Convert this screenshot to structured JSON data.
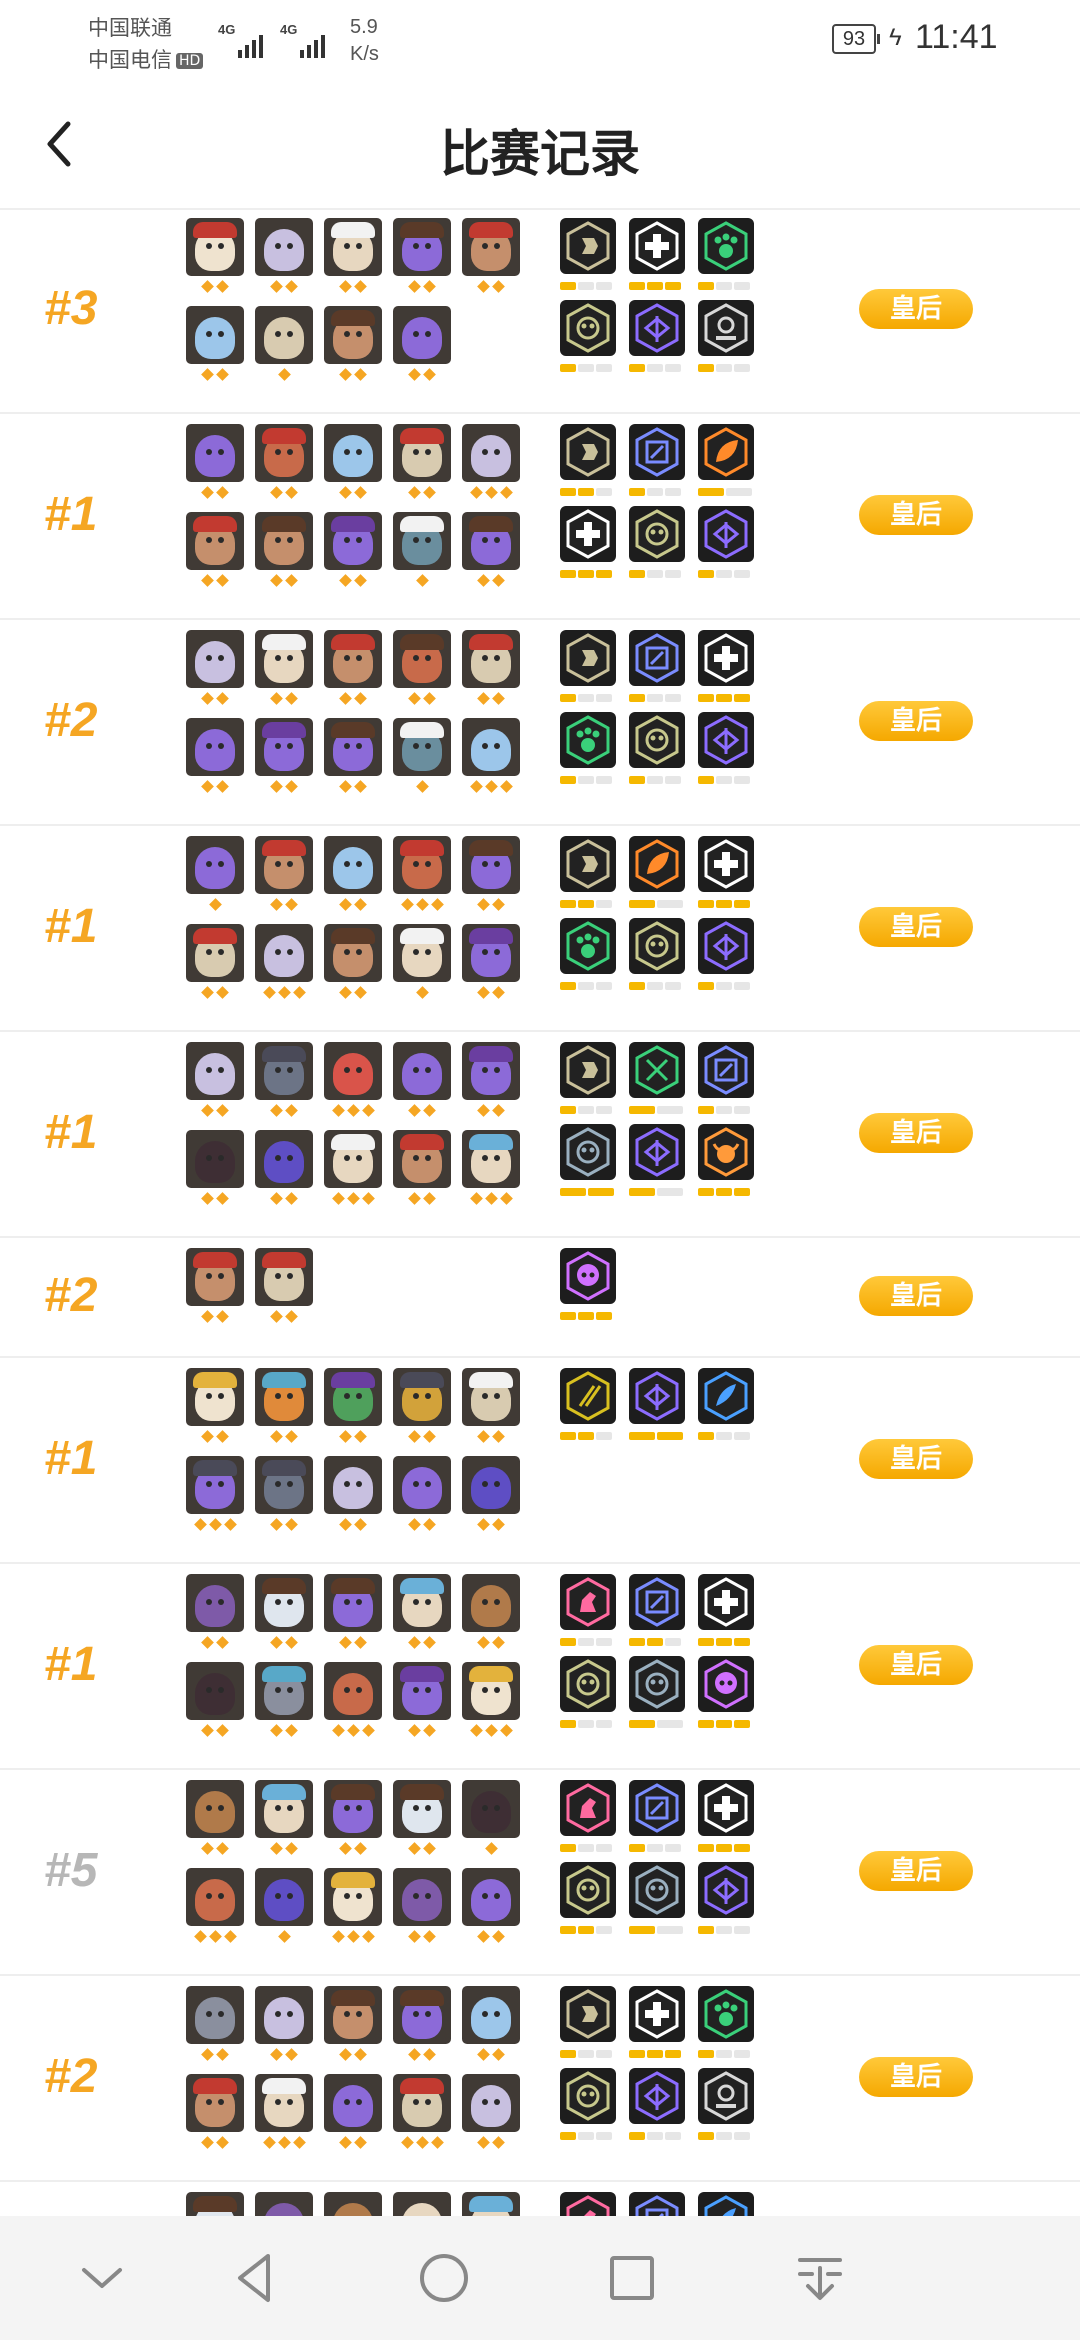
{
  "status_bar": {
    "carrier1": "中国联通",
    "carrier2": "中国电信",
    "hd": "HD",
    "net1": "4G",
    "net2": "4G",
    "speed_value": "5.9",
    "speed_unit": "K/s",
    "battery": "93",
    "time": "11:41"
  },
  "header": {
    "title": "比赛记录"
  },
  "matches": [
    {
      "rank": "#3",
      "tag": "皇后",
      "units": [
        [
          [
            2,
            "cream",
            "red"
          ],
          [
            2,
            "lilac",
            null
          ],
          [
            2,
            "beige",
            "white"
          ],
          [
            2,
            "violet",
            "horn"
          ],
          [
            2,
            "tan",
            "red"
          ]
        ],
        [
          [
            2,
            "sky",
            null
          ],
          [
            1,
            "bone",
            null
          ],
          [
            2,
            "tan",
            "horn"
          ],
          [
            2,
            "violet",
            null
          ]
        ]
      ],
      "synergies": [
        [
          [
            "axe",
            "#c9c09a",
            1,
            3
          ],
          [
            "cross",
            "#ffffff",
            3,
            3
          ],
          [
            "paw",
            "#3ad07a",
            1,
            3
          ]
        ],
        [
          [
            "claw",
            "#c7c88c",
            1,
            3
          ],
          [
            "fish",
            "#8c6cff",
            1,
            3
          ],
          [
            "ring",
            "#d8d8d8",
            1,
            3
          ]
        ]
      ]
    },
    {
      "rank": "#1",
      "tag": "皇后",
      "units": [
        [
          [
            2,
            "violet",
            null
          ],
          [
            2,
            "rust",
            "red"
          ],
          [
            2,
            "sky",
            null
          ],
          [
            2,
            "bone",
            "red"
          ],
          [
            3,
            "lilac",
            null
          ]
        ],
        [
          [
            2,
            "tan",
            "red"
          ],
          [
            2,
            "tan",
            "horn"
          ],
          [
            2,
            "violet",
            "mask"
          ],
          [
            1,
            "teal",
            "white"
          ],
          [
            2,
            "violet",
            "horn"
          ]
        ]
      ],
      "synergies": [
        [
          [
            "axe",
            "#c9c09a",
            2,
            3
          ],
          [
            "scroll",
            "#7a8cff",
            1,
            3
          ],
          [
            "leaf",
            "#ff8a2a",
            1,
            2
          ]
        ],
        [
          [
            "cross",
            "#ffffff",
            3,
            3
          ],
          [
            "claw",
            "#c7c88c",
            1,
            3
          ],
          [
            "fish",
            "#8c6cff",
            1,
            3
          ]
        ]
      ]
    },
    {
      "rank": "#2",
      "tag": "皇后",
      "units": [
        [
          [
            2,
            "lilac",
            null
          ],
          [
            2,
            "beige",
            "white"
          ],
          [
            2,
            "tan",
            "red"
          ],
          [
            2,
            "rust",
            "horn"
          ],
          [
            2,
            "bone",
            "red"
          ]
        ],
        [
          [
            2,
            "violet",
            null
          ],
          [
            2,
            "violet",
            "mask"
          ],
          [
            2,
            "violet",
            "horn"
          ],
          [
            1,
            "teal",
            "white"
          ],
          [
            3,
            "sky",
            null
          ]
        ]
      ],
      "synergies": [
        [
          [
            "axe",
            "#c9c09a",
            1,
            3
          ],
          [
            "scroll",
            "#7a8cff",
            1,
            3
          ],
          [
            "cross",
            "#ffffff",
            3,
            3
          ]
        ],
        [
          [
            "paw",
            "#3ad07a",
            1,
            3
          ],
          [
            "claw",
            "#c7c88c",
            1,
            3
          ],
          [
            "fish",
            "#8c6cff",
            1,
            3
          ]
        ]
      ]
    },
    {
      "rank": "#1",
      "tag": "皇后",
      "units": [
        [
          [
            1,
            "violet",
            null
          ],
          [
            2,
            "tan",
            "red"
          ],
          [
            2,
            "sky",
            null
          ],
          [
            3,
            "rust",
            "red"
          ],
          [
            2,
            "violet",
            "horn"
          ]
        ],
        [
          [
            2,
            "bone",
            "red"
          ],
          [
            3,
            "lilac",
            null
          ],
          [
            2,
            "tan",
            "horn"
          ],
          [
            1,
            "beige",
            "white"
          ],
          [
            2,
            "violet",
            "mask"
          ]
        ]
      ],
      "synergies": [
        [
          [
            "axe",
            "#c9c09a",
            2,
            3
          ],
          [
            "leaf",
            "#ff8a2a",
            1,
            2
          ],
          [
            "cross",
            "#ffffff",
            3,
            3
          ]
        ],
        [
          [
            "paw",
            "#3ad07a",
            1,
            3
          ],
          [
            "claw",
            "#c7c88c",
            1,
            3
          ],
          [
            "fish",
            "#8c6cff",
            1,
            3
          ]
        ]
      ]
    },
    {
      "rank": "#1",
      "tag": "皇后",
      "units": [
        [
          [
            2,
            "lilac",
            null
          ],
          [
            2,
            "slate",
            "hood"
          ],
          [
            3,
            "red",
            null
          ],
          [
            2,
            "violet",
            null
          ],
          [
            2,
            "violet",
            "mask"
          ]
        ],
        [
          [
            2,
            "dark",
            null
          ],
          [
            2,
            "indigo",
            null
          ],
          [
            3,
            "beige",
            "white"
          ],
          [
            2,
            "tan",
            "red"
          ],
          [
            3,
            "beige",
            "goggles"
          ]
        ]
      ],
      "synergies": [
        [
          [
            "axe",
            "#c9c09a",
            1,
            3
          ],
          [
            "arrows",
            "#3ad07a",
            1,
            2
          ],
          [
            "scroll",
            "#7a8cff",
            1,
            3
          ]
        ],
        [
          [
            "claw",
            "#9ab0c0",
            2,
            2
          ],
          [
            "fish",
            "#8c6cff",
            1,
            2
          ],
          [
            "bull",
            "#ff9a3a",
            3,
            3
          ]
        ]
      ]
    },
    {
      "rank": "#2",
      "tag": "皇后",
      "units": [
        [
          [
            2,
            "tan",
            "red"
          ],
          [
            2,
            "bone",
            "red"
          ]
        ]
      ],
      "synergies": [
        [
          [
            "skull",
            "#d070ff",
            3,
            3
          ]
        ]
      ]
    },
    {
      "rank": "#1",
      "tag": "皇后",
      "units": [
        [
          [
            2,
            "cream",
            "gold"
          ],
          [
            2,
            "orange",
            "helmet"
          ],
          [
            2,
            "green",
            "mask"
          ],
          [
            2,
            "gold",
            "hood"
          ],
          [
            2,
            "bone",
            "white"
          ]
        ],
        [
          [
            3,
            "violet",
            "hood"
          ],
          [
            2,
            "slate",
            "hood"
          ],
          [
            2,
            "lilac",
            null
          ],
          [
            2,
            "violet",
            null
          ],
          [
            2,
            "indigo",
            null
          ]
        ]
      ],
      "synergies": [
        [
          [
            "swords",
            "#d8c020",
            2,
            3
          ],
          [
            "fish",
            "#8c6cff",
            2,
            2
          ],
          [
            "feather",
            "#4aa0ff",
            1,
            3
          ]
        ]
      ]
    },
    {
      "rank": "#1",
      "tag": "皇后",
      "units": [
        [
          [
            2,
            "purple",
            null
          ],
          [
            2,
            "cloud",
            "horn"
          ],
          [
            2,
            "violet",
            "horn"
          ],
          [
            2,
            "beige",
            "goggles"
          ],
          [
            2,
            "wood",
            null
          ]
        ],
        [
          [
            2,
            "dark",
            null
          ],
          [
            2,
            "gray",
            "helmet"
          ],
          [
            3,
            "rust",
            null
          ],
          [
            2,
            "violet",
            "mask"
          ],
          [
            3,
            "cream",
            "gold"
          ]
        ]
      ],
      "synergies": [
        [
          [
            "knight",
            "#ff6aa0",
            1,
            3
          ],
          [
            "scroll",
            "#7a8cff",
            2,
            3
          ],
          [
            "cross",
            "#ffffff",
            3,
            3
          ]
        ],
        [
          [
            "claw",
            "#c7c88c",
            1,
            3
          ],
          [
            "claw",
            "#9ab0c0",
            1,
            2
          ],
          [
            "skull",
            "#d070ff",
            3,
            3
          ]
        ]
      ]
    },
    {
      "rank": "#5",
      "tag": "皇后",
      "low": true,
      "units": [
        [
          [
            2,
            "wood",
            null
          ],
          [
            2,
            "beige",
            "goggles"
          ],
          [
            2,
            "violet",
            "horn"
          ],
          [
            2,
            "cloud",
            "horn"
          ],
          [
            1,
            "dark",
            null
          ]
        ],
        [
          [
            3,
            "rust",
            null
          ],
          [
            1,
            "indigo",
            null
          ],
          [
            3,
            "cream",
            "gold"
          ],
          [
            2,
            "purple",
            null
          ],
          [
            2,
            "violet",
            null
          ]
        ]
      ],
      "synergies": [
        [
          [
            "knight",
            "#ff6aa0",
            1,
            3
          ],
          [
            "scroll",
            "#7a8cff",
            1,
            3
          ],
          [
            "cross",
            "#ffffff",
            3,
            3
          ]
        ],
        [
          [
            "claw",
            "#c7c88c",
            2,
            3
          ],
          [
            "claw",
            "#9ab0c0",
            1,
            2
          ],
          [
            "fish",
            "#8c6cff",
            1,
            3
          ]
        ]
      ]
    },
    {
      "rank": "#2",
      "tag": "皇后",
      "units": [
        [
          [
            2,
            "gray",
            null
          ],
          [
            2,
            "lilac",
            null
          ],
          [
            2,
            "tan",
            "horn"
          ],
          [
            2,
            "violet",
            "horn"
          ],
          [
            2,
            "sky",
            null
          ]
        ],
        [
          [
            2,
            "tan",
            "red"
          ],
          [
            3,
            "beige",
            "white"
          ],
          [
            2,
            "violet",
            null
          ],
          [
            3,
            "bone",
            "red"
          ],
          [
            2,
            "lilac",
            null
          ]
        ]
      ],
      "synergies": [
        [
          [
            "axe",
            "#c9c09a",
            1,
            3
          ],
          [
            "cross",
            "#ffffff",
            3,
            3
          ],
          [
            "paw",
            "#3ad07a",
            1,
            3
          ]
        ],
        [
          [
            "claw",
            "#c7c88c",
            1,
            3
          ],
          [
            "fish",
            "#8c6cff",
            1,
            3
          ],
          [
            "ring",
            "#d8d8d8",
            1,
            3
          ]
        ]
      ]
    },
    {
      "rank": "",
      "tag": "",
      "units": [
        [
          [
            2,
            "cloud",
            "horn"
          ],
          [
            2,
            "purple",
            null
          ],
          [
            2,
            "wood",
            null
          ],
          [
            2,
            "beige",
            null
          ],
          [
            2,
            "beige",
            "goggles"
          ]
        ]
      ],
      "synergies": [
        [
          [
            "knight",
            "#ff6aa0",
            1,
            3
          ],
          [
            "scroll",
            "#7a8cff",
            1,
            3
          ],
          [
            "feather",
            "#4aa0ff",
            1,
            3
          ]
        ]
      ]
    }
  ],
  "palette": {
    "violet": "#8c6ad8",
    "lilac": "#c8c0e0",
    "sky": "#9cc6ea",
    "cream": "#efe3cf",
    "beige": "#e7d7c0",
    "tan": "#c58f6c",
    "rust": "#c86a4a",
    "bone": "#d8cbb0",
    "teal": "#6a8e9e",
    "slate": "#6c7486",
    "red": "#d9544a",
    "dark": "#3e2e34",
    "indigo": "#5e4ec4",
    "orange": "#e08a3a",
    "green": "#4fa05c",
    "gold": "#d2a23a",
    "purple": "#7e5aa8",
    "cloud": "#dfe6ee",
    "wood": "#b07a4a",
    "gray": "#8a8f9e"
  },
  "nav": [
    "chevron-down-icon",
    "back-triangle-icon",
    "home-circle-icon",
    "recents-square-icon",
    "download-icon"
  ]
}
